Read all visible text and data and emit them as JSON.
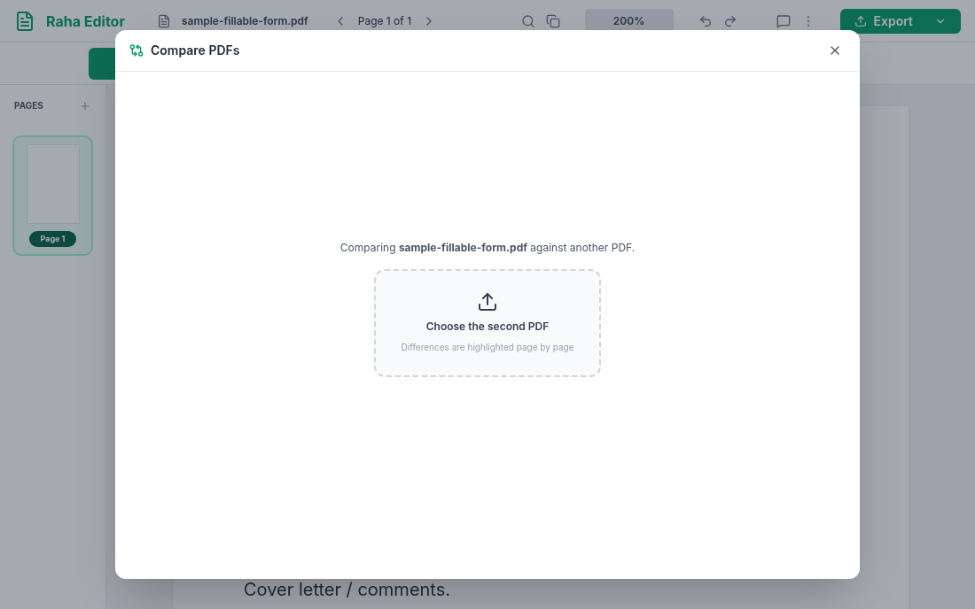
{
  "app": {
    "name": "Raha Editor",
    "file_name": "sample-fillable-form.pdf",
    "page_indicator": "Page 1 of 1",
    "zoom": "200%",
    "export_label": "Export"
  },
  "sidebar": {
    "title": "PAGES",
    "pages": [
      {
        "label": "Page 1",
        "selected": true
      }
    ]
  },
  "document": {
    "visible_text": "Cover letter / comments."
  },
  "dialog": {
    "title": "Compare PDFs",
    "intro": "Comparing **sample-fillable-form.pdf** against another PDF.",
    "drop_zone": {
      "title": "Choose the second PDF",
      "hint": "Differences are highlighted page by page"
    }
  }
}
